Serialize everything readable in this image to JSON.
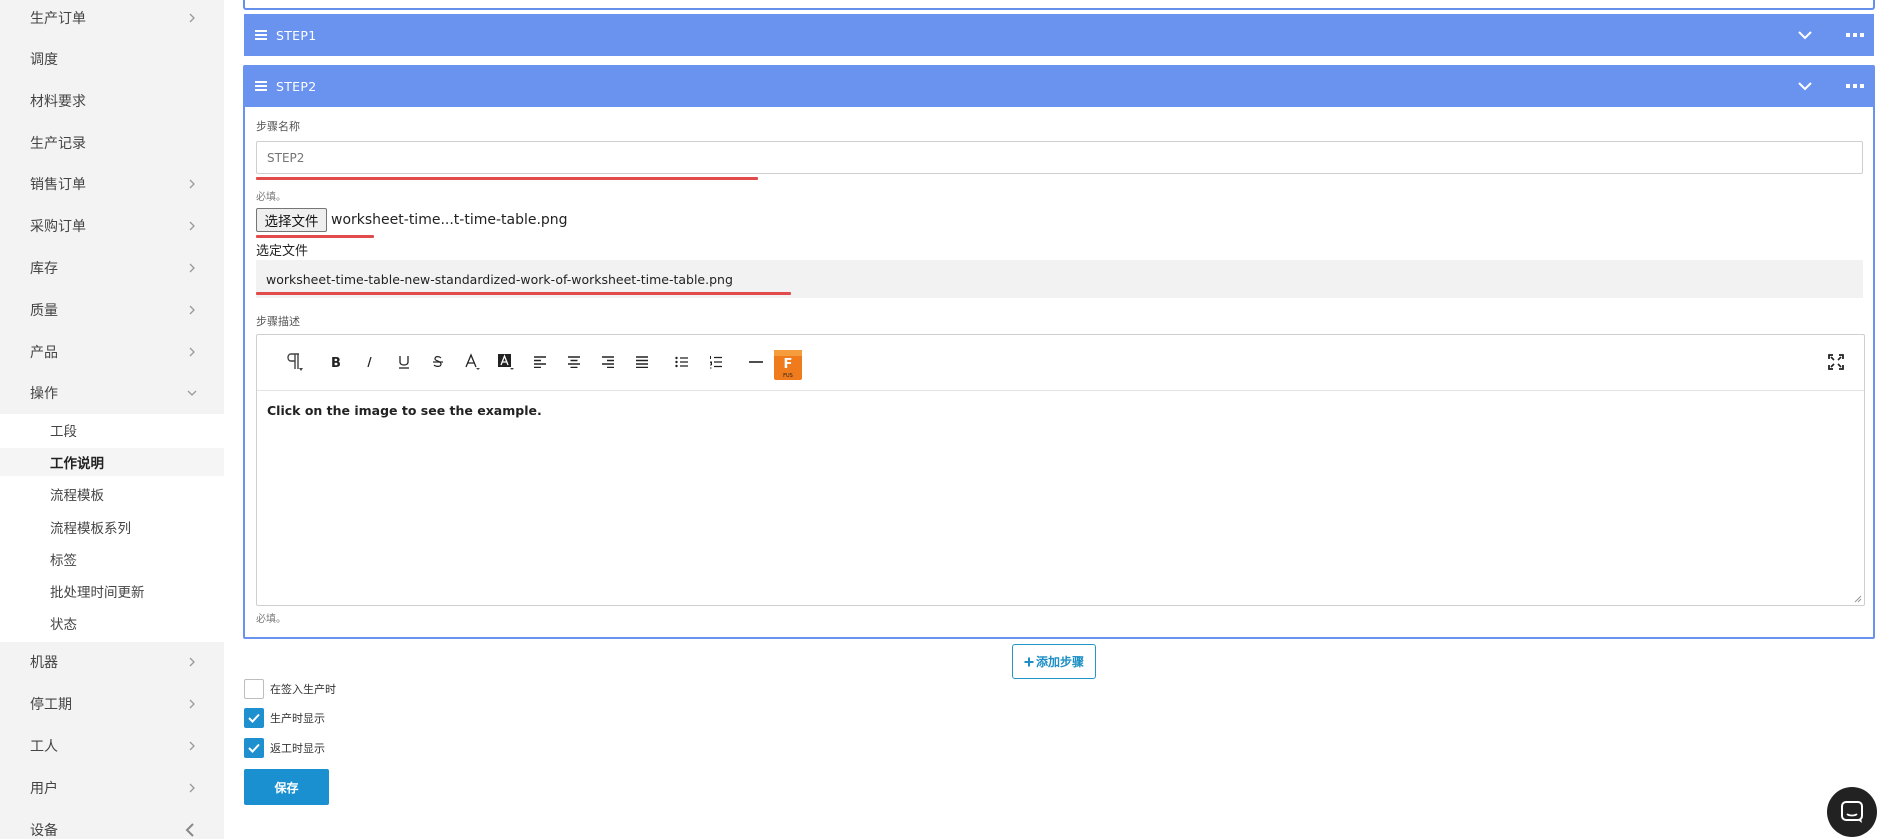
{
  "sidebar": {
    "items": [
      {
        "label": "生产订单"
      },
      {
        "label": "调度"
      },
      {
        "label": "材料要求"
      },
      {
        "label": "生产记录"
      },
      {
        "label": "销售订单"
      },
      {
        "label": "采购订单"
      },
      {
        "label": "库存"
      },
      {
        "label": "质量"
      },
      {
        "label": "产品"
      },
      {
        "label": "操作"
      },
      {
        "label": "机器"
      },
      {
        "label": "停工期"
      },
      {
        "label": "工人"
      },
      {
        "label": "用户"
      },
      {
        "label": "设备"
      }
    ],
    "sub_items": [
      {
        "label": "工段"
      },
      {
        "label": "工作说明",
        "active": true
      },
      {
        "label": "流程模板"
      },
      {
        "label": "流程模板系列"
      },
      {
        "label": "标签"
      },
      {
        "label": "批处理时间更新"
      },
      {
        "label": "状态"
      }
    ]
  },
  "steps": [
    {
      "title": "STEP1"
    },
    {
      "title": "STEP2"
    }
  ],
  "step2": {
    "name_label": "步骤名称",
    "name_placeholder": "STEP2",
    "required_hint": "必填。",
    "file_button_label": "选择文件",
    "file_name_display": "worksheet-time...t-time-table.png",
    "selected_file_label": "选定文件",
    "selected_file_value": "worksheet-time-table-new-standardized-work-of-worksheet-time-table.png",
    "description_label": "步骤描述",
    "editor_content": "Click on the image to see the example.",
    "required_hint_bottom": "必填。"
  },
  "toolbar": {
    "buttons": [
      "paragraph-format-icon",
      "bold-icon",
      "italic-icon",
      "underline-icon",
      "strikethrough-icon",
      "text-color-icon",
      "background-color-icon",
      "align-left-icon",
      "align-center-icon",
      "align-right-icon",
      "align-justify-icon",
      "unordered-list-icon",
      "ordered-list-icon",
      "horizontal-line-icon",
      "fusion-plugin-icon",
      "fullscreen-icon"
    ],
    "plugin_letter": "F",
    "plugin_sub": "FUS",
    "plugin_color": "#f07b1c"
  },
  "add_step_label": "添加步骤",
  "checkboxes": [
    {
      "label": "在签入生产时",
      "checked": false
    },
    {
      "label": "生产时显示",
      "checked": true
    },
    {
      "label": "返工时显示",
      "checked": true
    }
  ],
  "save_label": "保存",
  "colors": {
    "step_header": "#6a92ef",
    "accent": "#1a90d0",
    "underline_red": "#e24b4b"
  }
}
